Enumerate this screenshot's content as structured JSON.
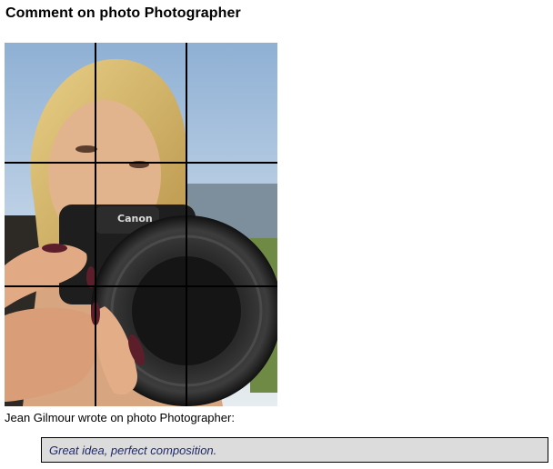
{
  "page": {
    "title": "Comment on photo Photographer"
  },
  "photo": {
    "subject": "woman holding camera",
    "camera_brand": "Canon",
    "grid_lines": "rule-of-thirds"
  },
  "comment": {
    "byline": "Jean Gilmour wrote on photo Photographer:",
    "text": "Great idea, perfect composition."
  },
  "colors": {
    "comment_bg": "#dcdcdc",
    "comment_text": "#1f2a6e"
  }
}
